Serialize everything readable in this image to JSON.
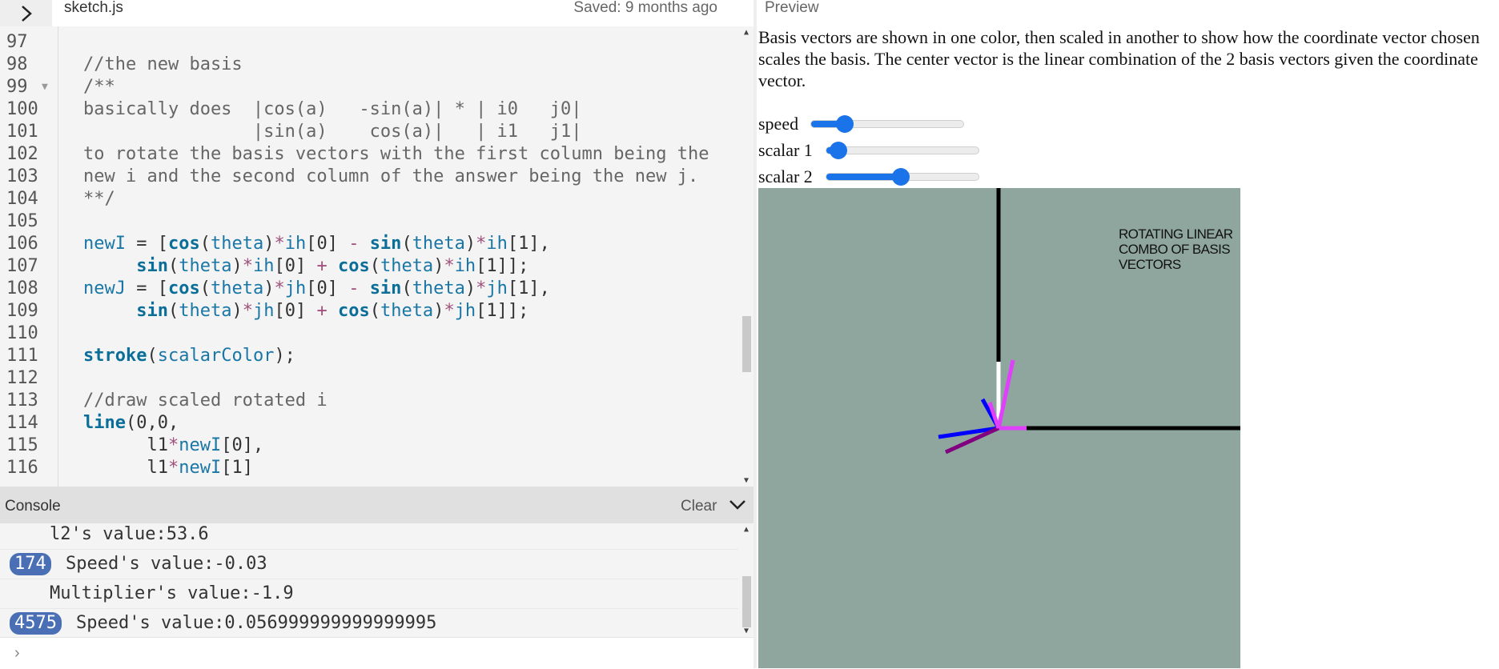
{
  "toolbar": {
    "file_name": "sketch.js",
    "saved_status": "Saved: 9 months ago",
    "preview_label": "Preview"
  },
  "editor": {
    "lines": [
      {
        "n": "97",
        "text": ""
      },
      {
        "n": "98",
        "text": "  //the new basis"
      },
      {
        "n": "99",
        "text": "  /**"
      },
      {
        "n": "100",
        "text": "  basically does  |cos(a)   -sin(a)| * | i0   j0|"
      },
      {
        "n": "101",
        "text": "                  |sin(a)    cos(a)|   | i1   j1|"
      },
      {
        "n": "102",
        "text": "  to rotate the basis vectors with the first column being the"
      },
      {
        "n": "103",
        "text": "  new i and the second column of the answer being the new j."
      },
      {
        "n": "104",
        "text": "  **/"
      },
      {
        "n": "105",
        "text": ""
      },
      {
        "n": "106",
        "text": "  newI = [cos(theta)*ih[0] - sin(theta)*ih[1],"
      },
      {
        "n": "107",
        "text": "       sin(theta)*ih[0] + cos(theta)*ih[1]];"
      },
      {
        "n": "108",
        "text": "  newJ = [cos(theta)*jh[0] - sin(theta)*jh[1],"
      },
      {
        "n": "109",
        "text": "       sin(theta)*jh[0] + cos(theta)*jh[1]];"
      },
      {
        "n": "110",
        "text": ""
      },
      {
        "n": "111",
        "text": "  stroke(scalarColor);"
      },
      {
        "n": "112",
        "text": ""
      },
      {
        "n": "113",
        "text": "  //draw scaled rotated i"
      },
      {
        "n": "114",
        "text": "  line(0,0,"
      },
      {
        "n": "115",
        "text": "        l1*newI[0],"
      },
      {
        "n": "116",
        "text": "        l1*newI[1]"
      }
    ]
  },
  "console": {
    "title": "Console",
    "clear_label": "Clear",
    "entries": [
      {
        "badge": "",
        "text": "l2's value:53.6"
      },
      {
        "badge": "174",
        "text": "Speed's value:-0.03"
      },
      {
        "badge": "",
        "text": "Multiplier's value:-1.9"
      },
      {
        "badge": "4575",
        "text": "Speed's value:0.056999999999999995"
      }
    ],
    "prompt_icon": "chevron-right-icon"
  },
  "preview": {
    "description": "Basis vectors are shown in one color, then scaled in another to show how the coordinate vector chosen scales the basis. The center vector is the linear combination of the 2 basis vectors given the coordinate vector.",
    "sliders": [
      {
        "label": "speed",
        "value": 0.22
      },
      {
        "label": "scalar 1",
        "value": 0.08
      },
      {
        "label": "scalar 2",
        "value": 0.49
      }
    ],
    "canvas_title": "ROTATING LINEAR COMBO OF BASIS VECTORS",
    "colors": {
      "canvas_bg": "#8fa69e",
      "axis": "#000000",
      "basis_i": "#0000ff",
      "basis_j": "#ffffff",
      "scaled_i": "#800080",
      "combo": "#e040fb",
      "slider_accent": "#1a73e8"
    }
  }
}
